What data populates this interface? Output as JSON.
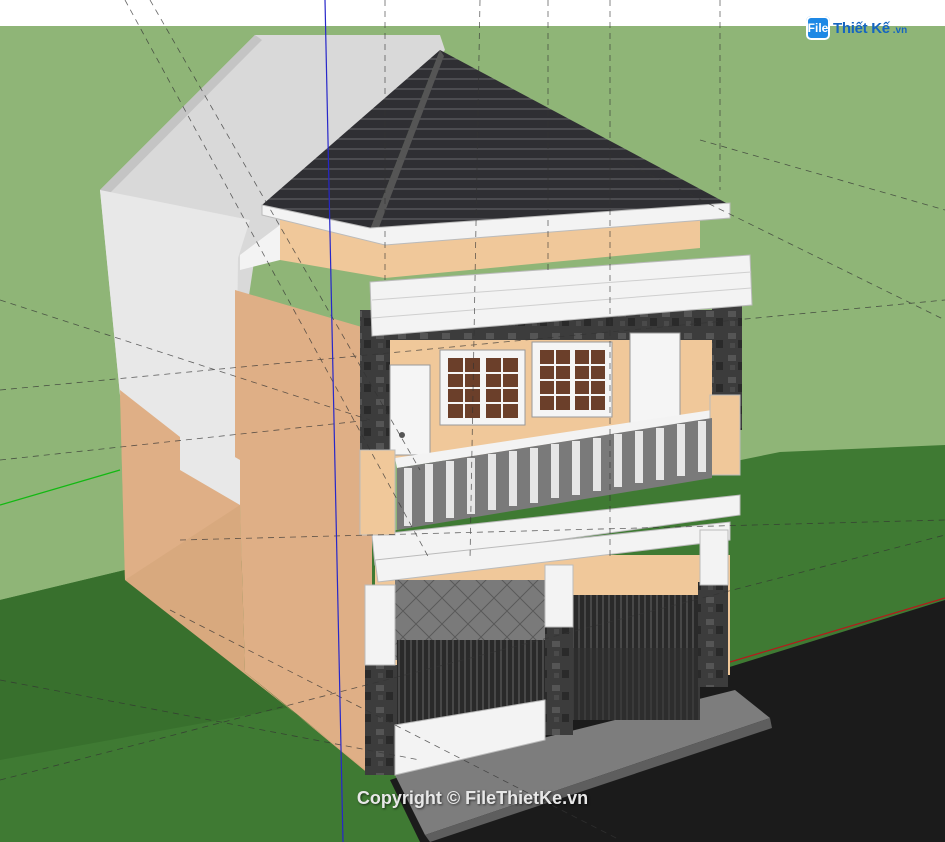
{
  "watermark": {
    "logo_mark": "File",
    "logo_text": "Thiết Kế",
    "logo_tld": ".vn",
    "copyright": "Copyright © FileThietKe.vn"
  },
  "colors": {
    "sky": "#ffffff",
    "ground": "#8fb577",
    "grass": "#3f7a33",
    "road": "#1b1b1b",
    "wall_orange": "#dcae84",
    "wall_orange_light": "#f0c89a",
    "stone": "#3c3c3c",
    "roof": "#2e2e32",
    "trim_white": "#f3f3f3",
    "neighbor_wall": "#d9d9d9"
  }
}
